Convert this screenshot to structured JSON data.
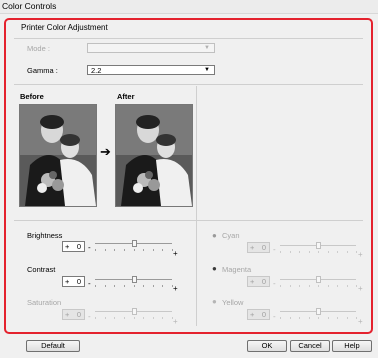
{
  "window": {
    "title": "Color Controls"
  },
  "group": {
    "title": "Printer Color Adjustment"
  },
  "mode": {
    "label": "Mode :",
    "value": ""
  },
  "gamma": {
    "label": "Gamma :",
    "value": "2.2"
  },
  "preview": {
    "before_label": "Before",
    "after_label": "After",
    "arrow": "➔"
  },
  "adjustments": {
    "brightness": {
      "label": "Brightness",
      "sign": "+",
      "value": "0",
      "minus": "-",
      "plus": "+",
      "level": 0.5
    },
    "contrast": {
      "label": "Contrast",
      "sign": "+",
      "value": "0",
      "minus": "-",
      "plus": "+",
      "level": 0.5
    },
    "saturation": {
      "label": "Saturation",
      "sign": "+",
      "value": "0",
      "minus": "-",
      "plus": "+",
      "level": 0.5
    },
    "cyan": {
      "label": "Cyan",
      "sign": "+",
      "value": "0",
      "minus": "-",
      "plus": "+",
      "level": 0.5
    },
    "magenta": {
      "label": "Magenta",
      "sign": "+",
      "value": "0",
      "minus": "-",
      "plus": "+",
      "level": 0.5
    },
    "yellow": {
      "label": "Yellow",
      "sign": "+",
      "value": "0",
      "minus": "-",
      "plus": "+",
      "level": 0.5
    }
  },
  "buttons": {
    "default": "Default",
    "ok": "OK",
    "cancel": "Cancel",
    "help": "Help"
  },
  "colors": {
    "highlight_frame": "#e4222e",
    "cyan": "#6a6a6a",
    "magenta": "#3a3a3a",
    "yellow": "#9a9a9a"
  }
}
